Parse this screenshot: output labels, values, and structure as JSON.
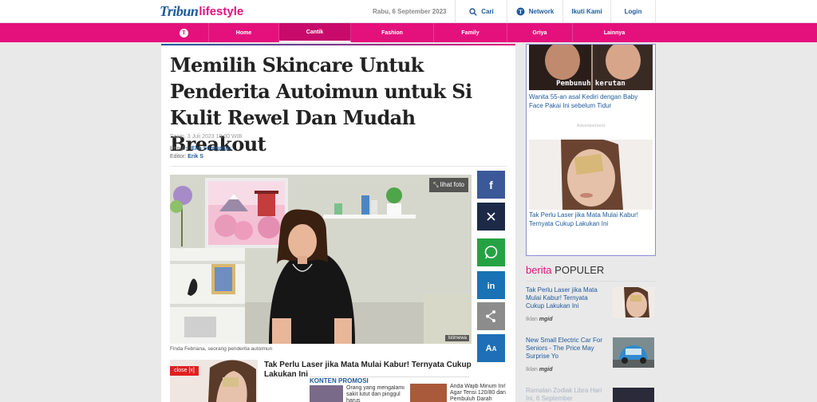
{
  "header": {
    "logo_tribun": "Tribun",
    "logo_lifestyle": "lifestyle",
    "date": "Rabu, 6 September 2023",
    "search_label": "Cari",
    "network_label": "Network",
    "follow_label": "Ikuti Kami",
    "login_label": "Login"
  },
  "nav": {
    "logo_glyph": "T",
    "items": [
      "Home",
      "Cantik",
      "Fashion",
      "Family",
      "Griya",
      "Lainnya"
    ],
    "active": "Cantik"
  },
  "article": {
    "title": "Memilih Skincare Untuk Penderita Autoimun untuk Si Kulit Rewel Dan Mudah Breakout",
    "published": "Senin, 3 Juli 2023 19:00 WIB",
    "writer_label": "Penulis:",
    "writer": "Eko Sutriyanto",
    "editor_label": "Editor:",
    "editor": "Erik S",
    "photo_button": "lihat foto",
    "photo_credit": "Istimewa",
    "caption": "Finda Febriana,  seorang penderita autoimun"
  },
  "share": [
    {
      "name": "facebook",
      "color": "#3b5998"
    },
    {
      "name": "x",
      "color": "#1c2a48"
    },
    {
      "name": "whatsapp",
      "color": "#25a244"
    },
    {
      "name": "linkedin",
      "color": "#1872b4"
    },
    {
      "name": "share",
      "color": "#8c8c8c"
    },
    {
      "name": "font-size",
      "color": "#1e6fb5"
    }
  ],
  "font_glyph": "A",
  "related": {
    "close_label": "close [x]",
    "title": "Tak Perlu Laser jika Mata Mulai Kabur! Ternyata Cukup Lakukan Ini"
  },
  "promo": {
    "heading": "KONTEN PROMOSI",
    "item1": "Orang yang mengalami sakit lutut dan pinggul harus",
    "item2": "Anda Wajib Minum Ini! Agar Tensi 120/80 dan Pembuluh Darah"
  },
  "sidebar": {
    "ad1_overlay": "Pembunuh kerutan",
    "ad1_text": "Wanita 55-an asal Kediri dengan Baby Face Pakai Ini sebelum Tidur",
    "ad_label": "Advertisement",
    "ad2_text": "Tak Perlu Laser jika Mata Mulai Kabur! Ternyata Cukup Lakukan Ini",
    "popular_a": "berita",
    "popular_b": "POPULER",
    "iklan_label": "Iklan",
    "mgid_label": "mgid",
    "pop1": "Tak Perlu Laser jika Mata Mulai Kabur! Ternyata Cukup Lakukan Ini",
    "pop2": "New Small Electric Car For Seniors - The Price May Surprise Yo",
    "pop3": "Ramalan Zodiak Libra Hari Ini, 6 September"
  },
  "colors": {
    "brand_blue": "#1e5a9c",
    "brand_pink": "#e4117d"
  }
}
